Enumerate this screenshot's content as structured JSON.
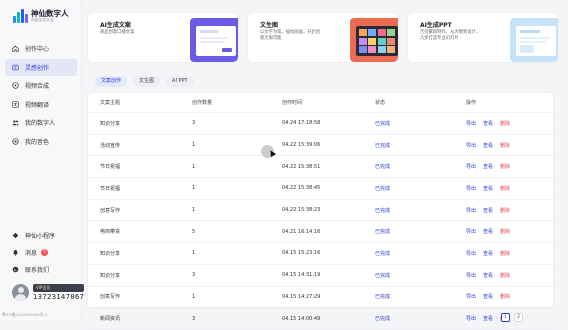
{
  "app": {
    "title": "神仙数字人",
    "subtitle": "内容生成平台"
  },
  "nav": [
    {
      "label": "创作中心",
      "icon": "home-icon"
    },
    {
      "label": "灵感创作",
      "icon": "lightbulb-icon",
      "active": true
    },
    {
      "label": "视频合成",
      "icon": "video-icon"
    },
    {
      "label": "视频翻译",
      "icon": "translate-icon"
    },
    {
      "label": "我的数字人",
      "icon": "people-icon"
    },
    {
      "label": "我的音色",
      "icon": "voice-icon"
    }
  ],
  "bottom_nav": [
    {
      "label": "神仙小程序",
      "icon": "miniapp-icon"
    },
    {
      "label": "消息",
      "icon": "bell-icon",
      "badge": "5"
    },
    {
      "label": "联系我们",
      "icon": "contact-icon"
    }
  ],
  "user": {
    "vip": "VIP会员",
    "phone": "13723147867"
  },
  "icp": "粤ICP备2022000040号-2",
  "cards": [
    {
      "title": "AI生成文案",
      "desc": "商品创意口播文案"
    },
    {
      "title": "文生图",
      "desc": "以文字为笔，描绘画面，开启创意无限可能"
    },
    {
      "title": "AI生成PPT",
      "desc": "告别繁琐制作，从大纲到设计，几步打造专业幻灯片"
    }
  ],
  "tabs": [
    "文案创作",
    "文生图",
    "AI PPT"
  ],
  "table": {
    "headers": [
      "文案主题",
      "创作数量",
      "创作时间",
      "状态",
      "操作"
    ],
    "actions": {
      "export": "导出",
      "view": "查看",
      "delete": "删除"
    },
    "rows": [
      {
        "topic": "知识分享",
        "count": "3",
        "time": "04.24 17:18:58",
        "status": "已完成"
      },
      {
        "topic": "活动宣传",
        "count": "1",
        "time": "04.22 15:39:06",
        "status": "已完成"
      },
      {
        "topic": "节日祝福",
        "count": "1",
        "time": "04.22 15:38:51",
        "status": "已完成"
      },
      {
        "topic": "节日祝福",
        "count": "1",
        "time": "04.22 15:38:45",
        "status": "已完成"
      },
      {
        "topic": "创意写作",
        "count": "1",
        "time": "04.22 15:38:23",
        "status": "已完成"
      },
      {
        "topic": "电商带货",
        "count": "5",
        "time": "04.21 16:14:16",
        "status": "已完成"
      },
      {
        "topic": "知识分享",
        "count": "1",
        "time": "04.15 15:23:16",
        "status": "已完成"
      },
      {
        "topic": "知识分享",
        "count": "3",
        "time": "04.15 14:31:19",
        "status": "已完成"
      },
      {
        "topic": "创意写作",
        "count": "1",
        "time": "04.15 14:27:29",
        "status": "已完成"
      },
      {
        "topic": "新闻资讯",
        "count": "3",
        "time": "04.15 14:00:49",
        "status": "已完成"
      }
    ]
  },
  "pager": {
    "prev": "‹",
    "pages": [
      "1",
      "2"
    ],
    "current": "1",
    "next": "›"
  },
  "colors": {
    "accent": "#2f3dd6",
    "danger": "#e5484d",
    "card1": "#6b5ce7",
    "card2": "#ee6b52",
    "card3": "#c6e3f7"
  }
}
